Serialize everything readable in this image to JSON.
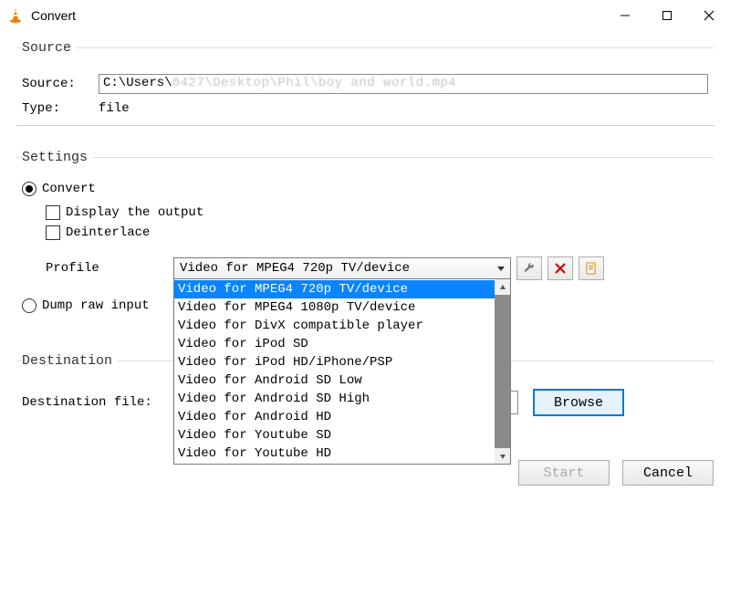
{
  "window": {
    "title": "Convert"
  },
  "source": {
    "legend": "Source",
    "source_label": "Source:",
    "source_value_prefix": "C:\\Users\\",
    "source_value_blur": "0427\\Desktop\\Phil\\boy and world.mp4",
    "type_label": "Type:",
    "type_value": "file"
  },
  "settings": {
    "legend": "Settings",
    "convert_label": "Convert",
    "display_output_label": "Display the output",
    "deinterlace_label": "Deinterlace",
    "profile_label": "Profile",
    "profile_selected": "Video for MPEG4 720p TV/device",
    "profile_options": [
      "Video for MPEG4 720p TV/device",
      "Video for MPEG4 1080p TV/device",
      "Video for DivX compatible player",
      "Video for iPod SD",
      "Video for iPod HD/iPhone/PSP",
      "Video for Android SD Low",
      "Video for Android SD High",
      "Video for Android HD",
      "Video for Youtube SD",
      "Video for Youtube HD"
    ],
    "dump_label": "Dump raw input"
  },
  "destination": {
    "legend": "Destination",
    "file_label": "Destination file:",
    "browse_label": "Browse"
  },
  "footer": {
    "start_label": "Start",
    "cancel_label": "Cancel"
  }
}
